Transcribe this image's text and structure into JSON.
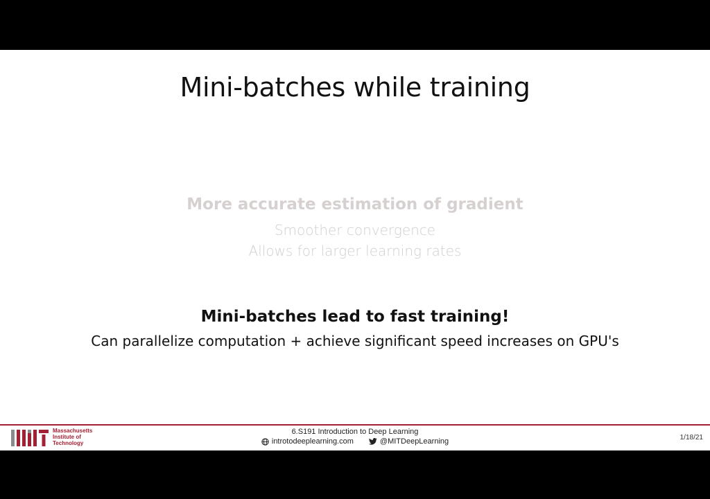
{
  "slide": {
    "title": "Mini-batches while training",
    "faded_block": {
      "heading": "More accurate estimation of gradient",
      "lines": [
        "Smoother convergence",
        "Allows for larger learning rates"
      ]
    },
    "highlight_block": {
      "heading": "Mini-batches lead to fast training!",
      "line": "Can parallelize computation + achieve significant speed increases on GPU's"
    }
  },
  "footer": {
    "institution": [
      "Massachusetts",
      "Institute of",
      "Technology"
    ],
    "course": "6.S191 Introduction to Deep Learning",
    "website": "introtodeeplearning.com",
    "twitter": "@MITDeepLearning",
    "date": "1/18/21",
    "icons": [
      "mit-logo",
      "globe-icon",
      "twitter-icon"
    ],
    "accent_color": "#a31f34"
  }
}
